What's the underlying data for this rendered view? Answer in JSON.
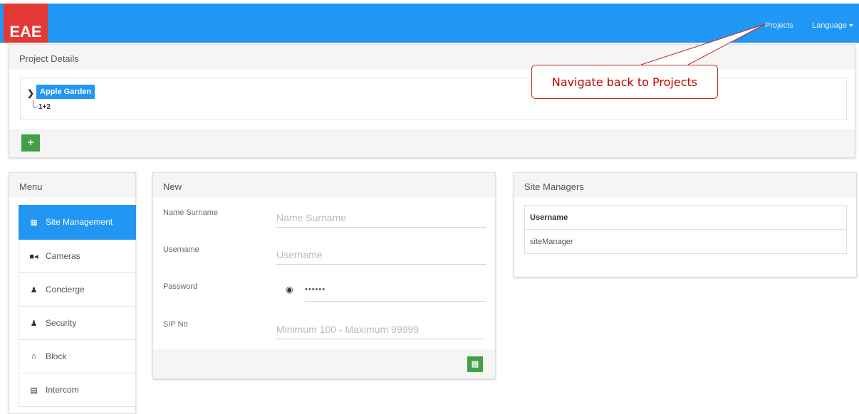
{
  "header": {
    "logo": "EAE",
    "nav": {
      "projects": "Projects",
      "language": "Language"
    }
  },
  "project_details": {
    "title": "Project Details",
    "tree": {
      "root": "Apple Garden",
      "child": "1+2"
    },
    "add_label": "+"
  },
  "annotation": {
    "callout": "Navigate back to Projects"
  },
  "menu": {
    "title": "Menu",
    "items": [
      {
        "label": "Site Management",
        "icon": "list-icon",
        "active": true
      },
      {
        "label": "Cameras",
        "icon": "video-camera-icon",
        "active": false
      },
      {
        "label": "Concierge",
        "icon": "user-icon",
        "active": false
      },
      {
        "label": "Security",
        "icon": "user-icon",
        "active": false
      },
      {
        "label": "Block",
        "icon": "home-icon",
        "active": false
      },
      {
        "label": "Intercom",
        "icon": "intercom-icon",
        "active": false
      }
    ]
  },
  "new_form": {
    "title": "New",
    "fields": {
      "name": {
        "label": "Name Surname",
        "placeholder": "Name Surname"
      },
      "username": {
        "label": "Username",
        "placeholder": "Username"
      },
      "password": {
        "label": "Password",
        "value": "••••••"
      },
      "sip": {
        "label": "SIP No",
        "placeholder": "Minimum 100 - Maximum 99999"
      }
    },
    "save_icon": "save-icon"
  },
  "site_managers": {
    "title": "Site Managers",
    "columns": [
      "Username"
    ],
    "rows": [
      [
        "siteManager"
      ]
    ]
  },
  "colors": {
    "topbar": "#2196f3",
    "logo": "#e53935",
    "primary": "#2196f3",
    "success": "#43a047",
    "annotation": "#c00000"
  }
}
